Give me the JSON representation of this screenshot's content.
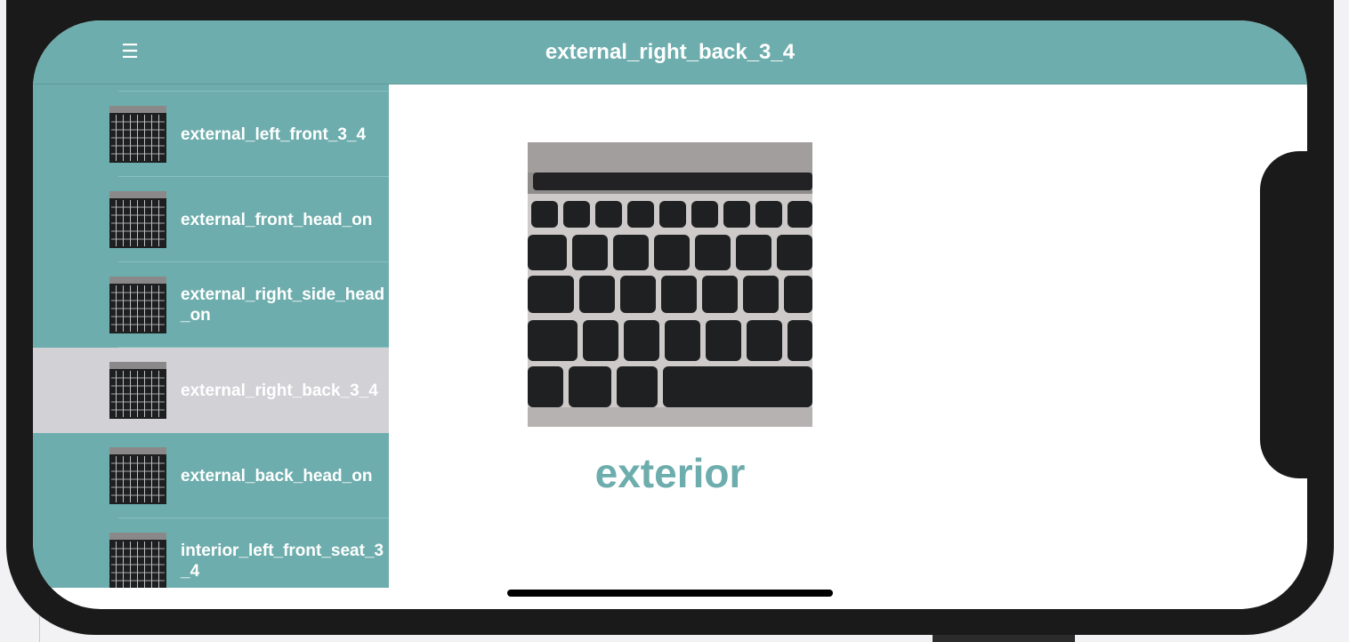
{
  "nav": {
    "title": "external_right_back_3_4",
    "menu_icon": "☰"
  },
  "sidebar": {
    "items": [
      {
        "label": "external_left_front_3_4",
        "selected": false
      },
      {
        "label": "external_front_head_on",
        "selected": false
      },
      {
        "label": "external_right_side_head_on",
        "selected": false
      },
      {
        "label": "external_right_back_3_4",
        "selected": true
      },
      {
        "label": "external_back_head_on",
        "selected": false
      },
      {
        "label": "interior_left_front_seat_3_4",
        "selected": false
      }
    ]
  },
  "detail": {
    "image_icon": "keyboard-photo",
    "caption": "exterior"
  },
  "colors": {
    "accent": "#6eadad",
    "selected_row": "#d1d1d6",
    "text_on_accent": "#ffffff"
  }
}
